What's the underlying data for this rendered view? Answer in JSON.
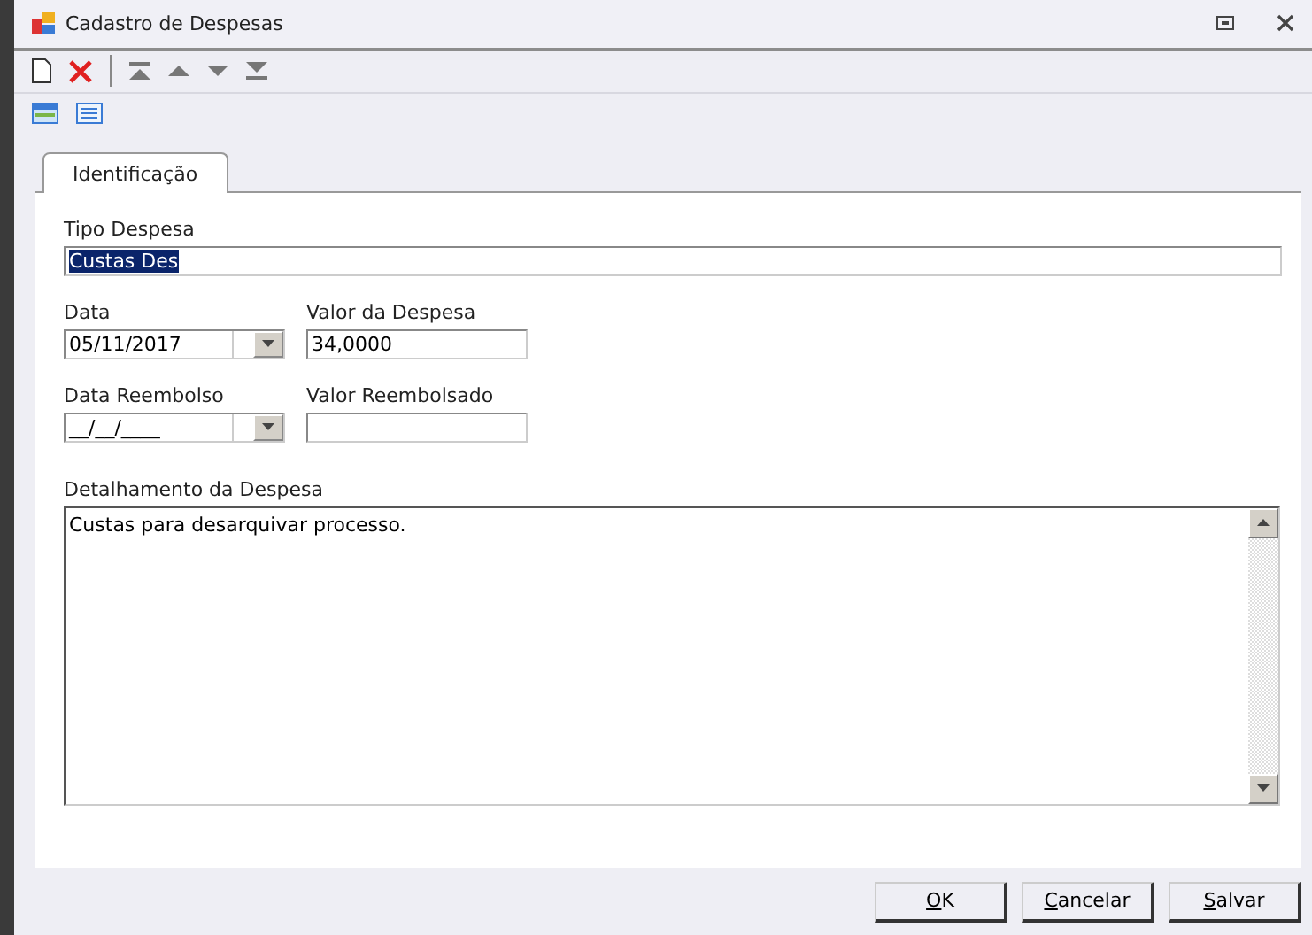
{
  "window": {
    "title": "Cadastro de Despesas"
  },
  "tabs": [
    {
      "label": "Identificação",
      "selected": true
    }
  ],
  "form": {
    "tipo": {
      "label": "Tipo Despesa",
      "value": "Custas Des",
      "selected_text": true
    },
    "data": {
      "label": "Data",
      "value": "05/11/2017"
    },
    "valor": {
      "label": "Valor da Despesa",
      "value": "34,0000"
    },
    "data_reembolso": {
      "label": "Data Reembolso",
      "value": "__/__/____"
    },
    "valor_reembolsado": {
      "label": "Valor Reembolsado"
    },
    "detalhamento": {
      "label": "Detalhamento da Despesa",
      "value": "Custas para desarquivar processo."
    }
  },
  "buttons": [
    {
      "label": "OK"
    },
    {
      "label": "Cancelar"
    },
    {
      "label": "Salvar"
    }
  ]
}
